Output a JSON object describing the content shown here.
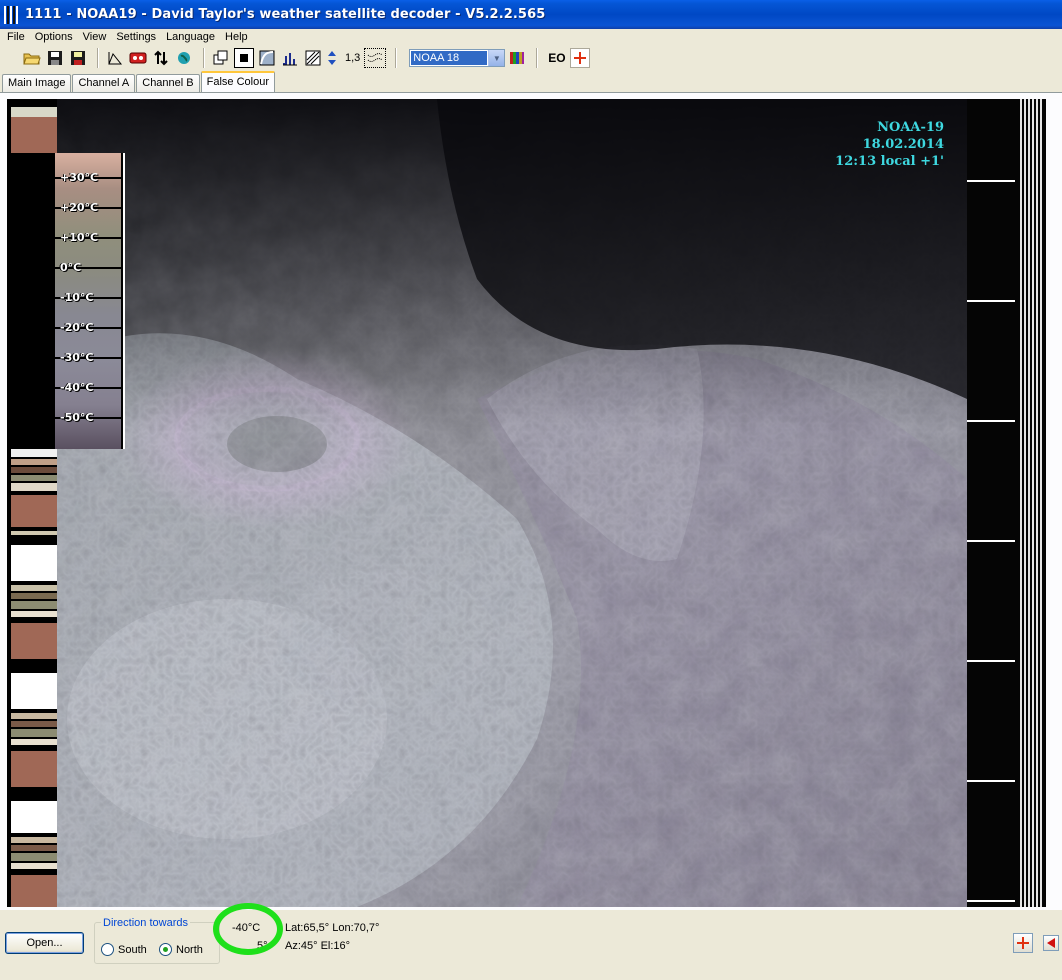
{
  "window": {
    "title": "1111 - NOAA19 - David Taylor's weather satellite decoder - V5.2.2.565",
    "icon": "barcode-app-icon"
  },
  "menu": [
    "File",
    "Options",
    "View",
    "Settings",
    "Language",
    "Help"
  ],
  "toolbar": {
    "zoom_text": "1,3",
    "satellite_select": "NOAA 18",
    "eo_label": "EO",
    "icons": [
      "open-folder-icon",
      "save-icon",
      "save-all-icon",
      "crop-icon",
      "tape-icon",
      "contrast-arrows-icon",
      "globe-icon",
      "copy-icon",
      "frame-icon",
      "curve-icon",
      "histogram-icon",
      "gamma-icon",
      "spin-icon",
      "noise-filter-icon",
      "palette-icon",
      "crosshair-icon"
    ]
  },
  "tabs": [
    {
      "label": "Main Image",
      "active": false
    },
    {
      "label": "Channel A",
      "active": false
    },
    {
      "label": "Channel B",
      "active": false
    },
    {
      "label": "False Colour",
      "active": true
    }
  ],
  "image": {
    "overlay": {
      "satellite": "NOAA-19",
      "date": "18.02.2014",
      "time": "12:13 local +1'"
    },
    "temperature_scale": [
      "+30°C",
      "+20°C",
      "+10°C",
      "0°C",
      "-10°C",
      "-20°C",
      "-30°C",
      "-40°C",
      "-50°C"
    ],
    "colors": {
      "overlay_text": "#3ed8e0",
      "background": "#000000"
    }
  },
  "status": {
    "open_button": "Open...",
    "direction": {
      "legend": "Direction towards",
      "options": [
        {
          "label": "South",
          "checked": false
        },
        {
          "label": "North",
          "checked": true
        }
      ]
    },
    "temperature": "-40°C",
    "lat_lon": "Lat:65,5°  Lon:70,7°",
    "az_el": "Az:45°  El:16°",
    "partial_value": "5°",
    "highlight_color": "#1ee01a"
  }
}
